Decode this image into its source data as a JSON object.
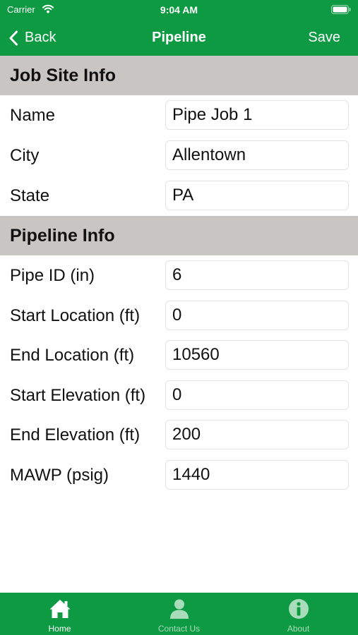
{
  "status_bar": {
    "carrier": "Carrier",
    "time": "9:04 AM"
  },
  "nav": {
    "back_label": "Back",
    "title": "Pipeline",
    "save_label": "Save"
  },
  "job_site": {
    "header": "Job Site Info",
    "name": {
      "label": "Name",
      "value": "Pipe Job 1"
    },
    "city": {
      "label": "City",
      "value": "Allentown"
    },
    "state": {
      "label": "State",
      "value": "PA"
    }
  },
  "pipeline": {
    "header": "Pipeline Info",
    "pipe_id": {
      "label": "Pipe ID (in)",
      "value": "6"
    },
    "start_location": {
      "label": "Start Location (ft)",
      "value": "0"
    },
    "end_location": {
      "label": "End Location (ft)",
      "value": "10560"
    },
    "start_elevation": {
      "label": "Start Elevation (ft)",
      "value": "0"
    },
    "end_elevation": {
      "label": "End Elevation (ft)",
      "value": "200"
    },
    "mawp": {
      "label": "MAWP (psig)",
      "value": "1440"
    }
  },
  "tabbar": {
    "home": {
      "label": "Home",
      "icon": "home-icon"
    },
    "contact": {
      "label": "Contact Us",
      "icon": "person-icon"
    },
    "about": {
      "label": "About",
      "icon": "info-icon"
    }
  },
  "colors": {
    "brand_green": "#0d9a43",
    "section_gray": "#c8c5c2",
    "inactive_tab": "#a9dcba"
  }
}
